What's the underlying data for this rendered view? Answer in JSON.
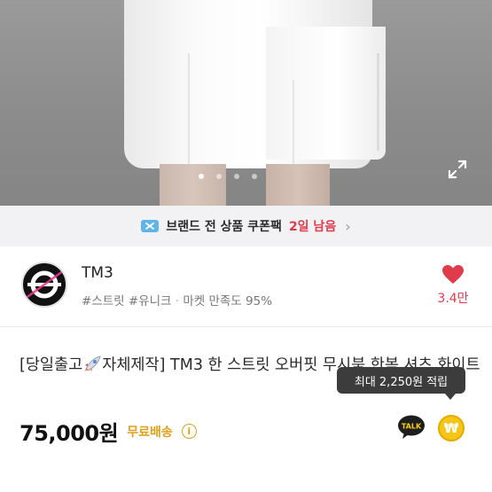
{
  "hero": {
    "page_count": 4,
    "active_index": 0
  },
  "coupon": {
    "text": "브랜드 전 상품 쿠폰팩",
    "days_left": "2일 남음",
    "chevron": "›"
  },
  "shop": {
    "name": "TM3",
    "tags": "#스트릿 #유니크",
    "separator": "·",
    "rating": "마켓 만족도 95%",
    "likes": "3.4만"
  },
  "product": {
    "title_prefix": "[당일출고",
    "title_rest": "자체제작] TM3 한 스트릿 오버핏 무시북 한복 셔츠 화이트",
    "price": "75,000원",
    "shipping": "무료배송",
    "info_glyph": "i",
    "tooltip": "최대 2,250원 적립",
    "talk_label": "TALK",
    "won_glyph": "₩"
  },
  "colors": {
    "accent_red": "#e03b4a",
    "shipping_yellow": "#e0a019",
    "coupon_bg": "#f2f2f5"
  }
}
